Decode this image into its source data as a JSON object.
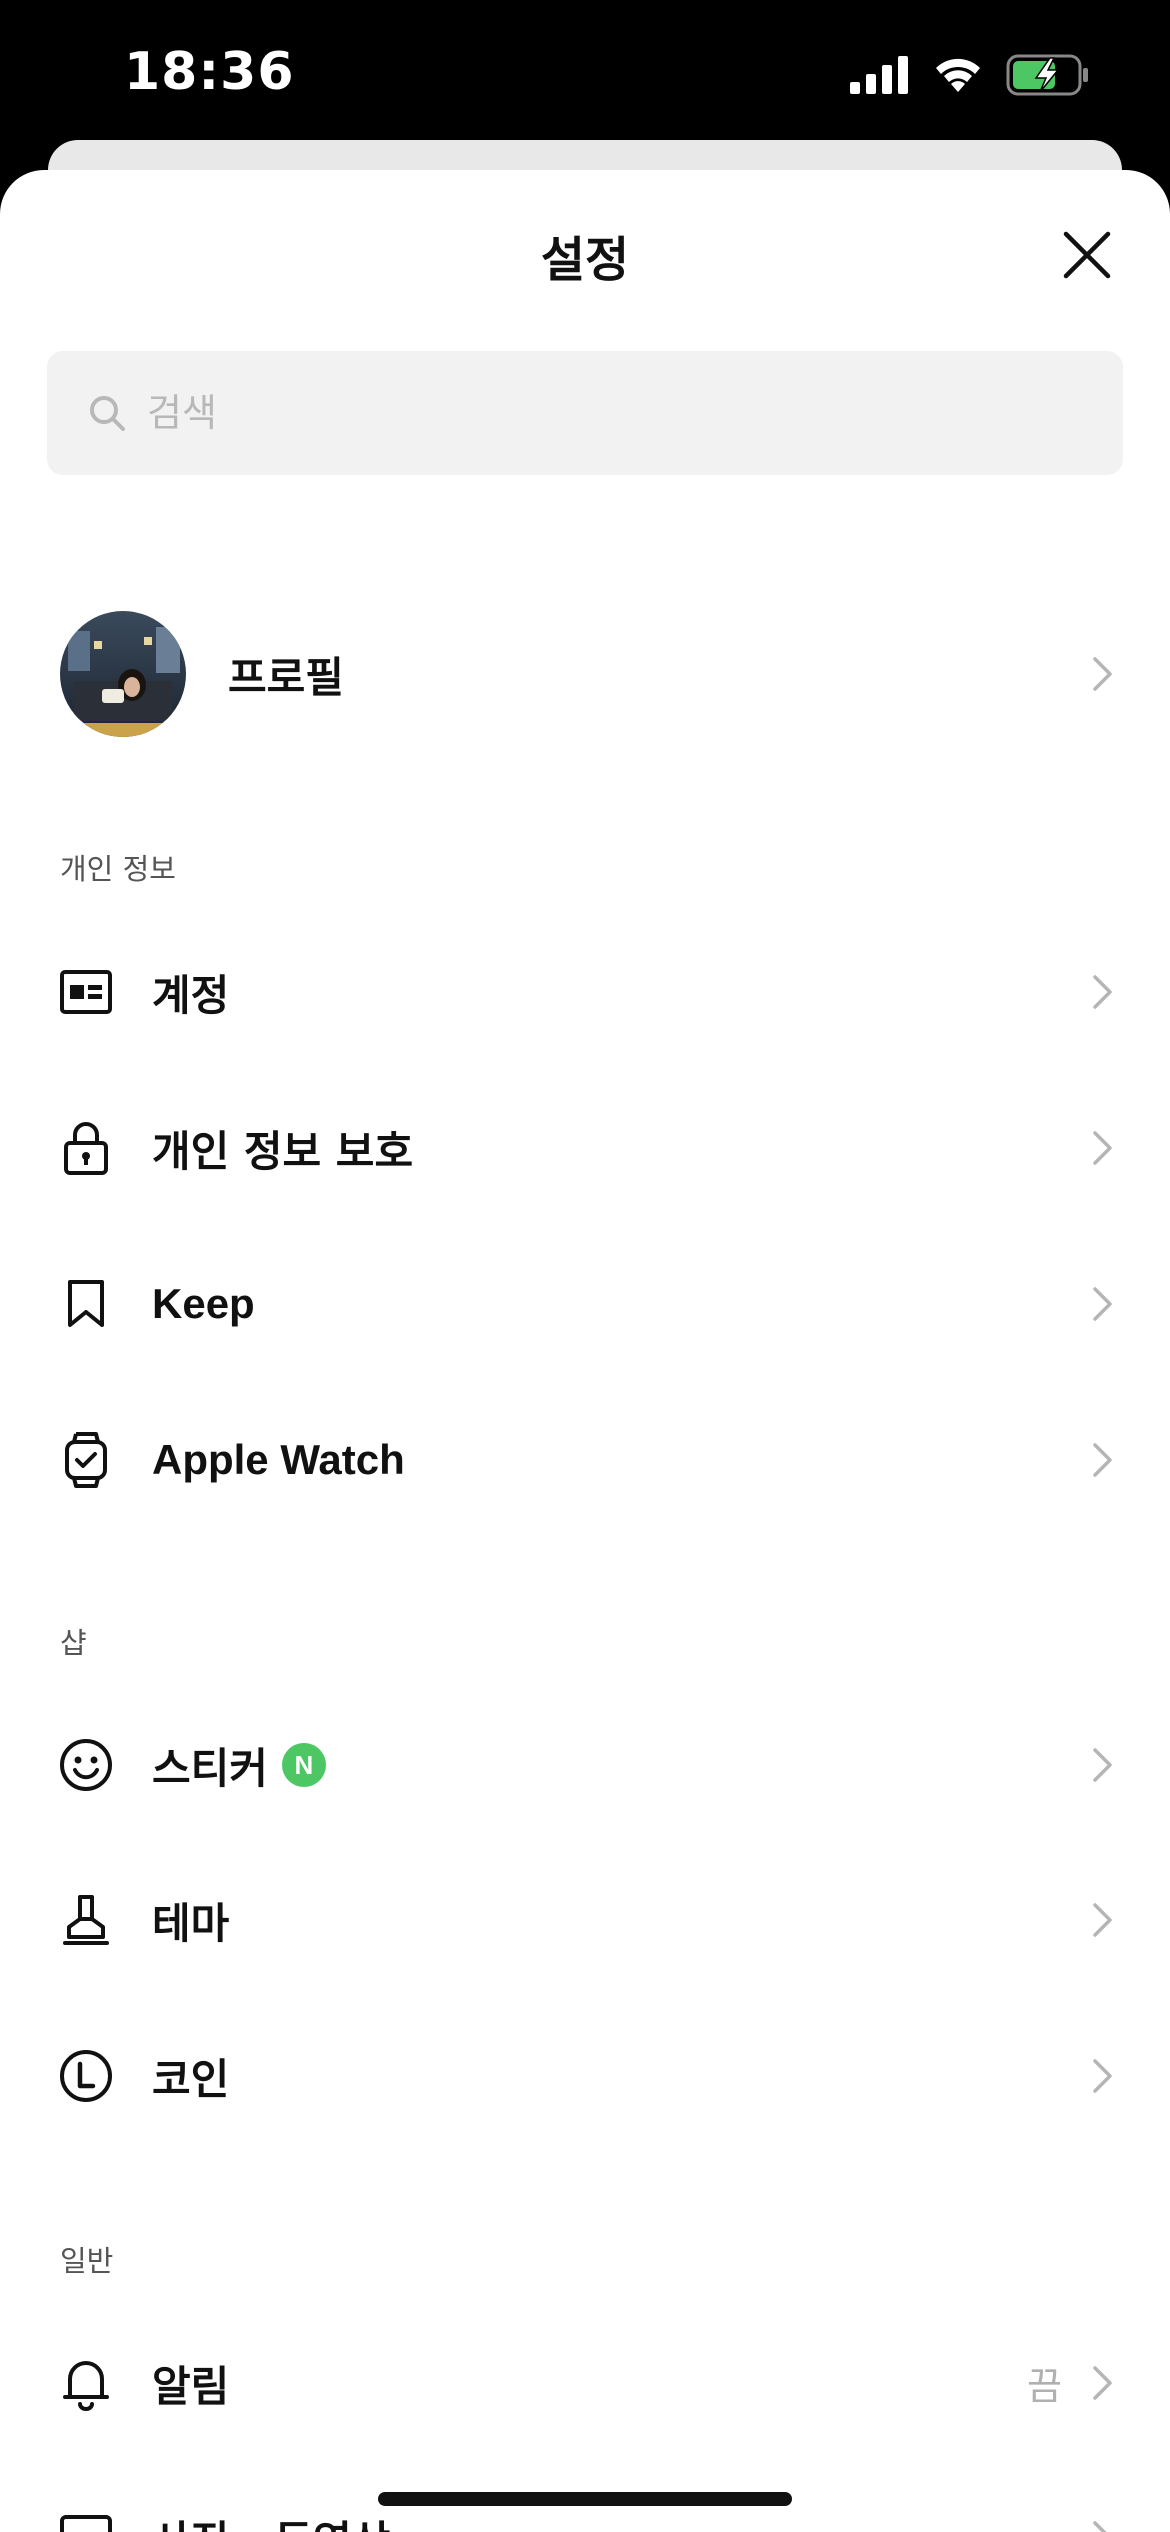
{
  "status_bar": {
    "time": "18:36"
  },
  "header": {
    "title": "설정"
  },
  "search": {
    "placeholder": "검색"
  },
  "profile": {
    "label": "프로필"
  },
  "sections": {
    "personal": {
      "label": "개인 정보",
      "items": [
        {
          "label": "계정",
          "icon": "id-card-icon"
        },
        {
          "label": "개인 정보 보호",
          "icon": "lock-icon"
        },
        {
          "label": "Keep",
          "icon": "bookmark-icon"
        },
        {
          "label": "Apple Watch",
          "icon": "watch-icon"
        }
      ]
    },
    "shop": {
      "label": "샵",
      "items": [
        {
          "label": "스티커",
          "icon": "smiley-icon",
          "badge": "N"
        },
        {
          "label": "테마",
          "icon": "brush-icon"
        },
        {
          "label": "코인",
          "icon": "coin-icon"
        }
      ]
    },
    "general": {
      "label": "일반",
      "items": [
        {
          "label": "알림",
          "icon": "bell-icon",
          "value": "끔"
        },
        {
          "label": "사진 · 동영상",
          "icon": "photo-icon"
        }
      ]
    }
  },
  "colors": {
    "badge_green": "#4cc764",
    "chevron": "#b5b5b5",
    "search_bg": "#f2f2f2"
  }
}
